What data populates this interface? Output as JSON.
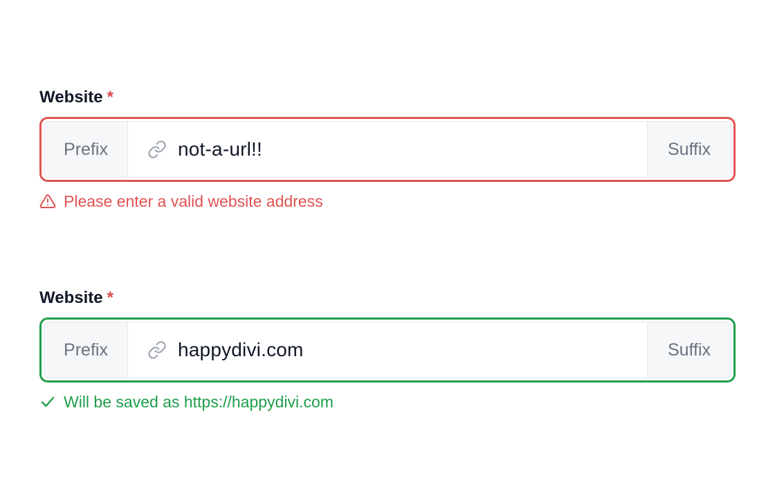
{
  "fields": [
    {
      "label": "Website",
      "required_mark": "*",
      "prefix": "Prefix",
      "suffix": "Suffix",
      "value": "not-a-url!!",
      "state": "invalid",
      "message": "Please enter a valid website address",
      "message_icon": "warning-icon"
    },
    {
      "label": "Website",
      "required_mark": "*",
      "prefix": "Prefix",
      "suffix": "Suffix",
      "value": "happydivi.com",
      "state": "valid",
      "message": "Will be saved as https://happydivi.com",
      "message_icon": "check-icon"
    }
  ],
  "colors": {
    "error": "#e05252",
    "success": "#1e9e4a",
    "label": "#111827",
    "addon_bg": "#f6f7f9",
    "addon_text": "#6b7280",
    "icon": "#9ca3af"
  },
  "icons": {
    "input_leading": "link-icon"
  }
}
